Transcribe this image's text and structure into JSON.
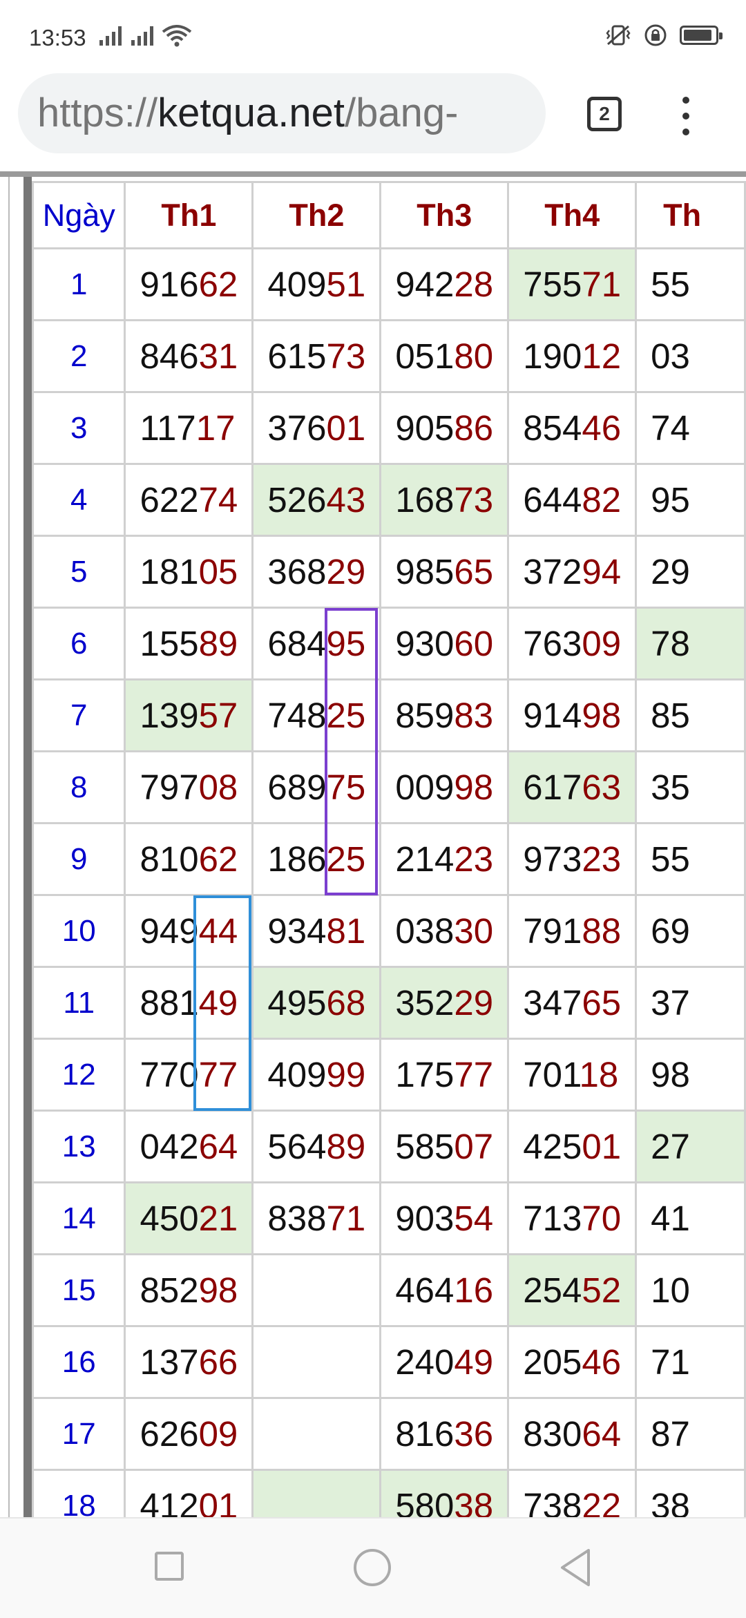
{
  "status_bar": {
    "time": "13:53",
    "icons": [
      "signal-icon",
      "signal-icon",
      "wifi-icon",
      "vibrate-icon",
      "rotation-lock-icon",
      "battery-icon"
    ]
  },
  "browser": {
    "url_scheme": "https://",
    "url_host": "ketqua.net",
    "url_path": "/bang-",
    "tab_count": "2"
  },
  "table": {
    "headers": [
      "Ngày",
      "Th1",
      "Th2",
      "Th3",
      "Th4",
      "Th"
    ],
    "rows": [
      {
        "day": "1",
        "cells": [
          {
            "h": "916",
            "t": "62"
          },
          {
            "h": "409",
            "t": "51"
          },
          {
            "h": "942",
            "t": "28"
          },
          {
            "h": "755",
            "t": "71"
          },
          {
            "h": "55",
            "t": ""
          }
        ]
      },
      {
        "day": "2",
        "cells": [
          {
            "h": "846",
            "t": "31"
          },
          {
            "h": "615",
            "t": "73"
          },
          {
            "h": "051",
            "t": "80"
          },
          {
            "h": "190",
            "t": "12"
          },
          {
            "h": "03",
            "t": ""
          }
        ]
      },
      {
        "day": "3",
        "cells": [
          {
            "h": "117",
            "t": "17"
          },
          {
            "h": "376",
            "t": "01"
          },
          {
            "h": "905",
            "t": "86"
          },
          {
            "h": "854",
            "t": "46"
          },
          {
            "h": "74",
            "t": ""
          }
        ]
      },
      {
        "day": "4",
        "cells": [
          {
            "h": "622",
            "t": "74"
          },
          {
            "h": "526",
            "t": "43"
          },
          {
            "h": "168",
            "t": "73"
          },
          {
            "h": "644",
            "t": "82"
          },
          {
            "h": "95",
            "t": ""
          }
        ]
      },
      {
        "day": "5",
        "cells": [
          {
            "h": "181",
            "t": "05"
          },
          {
            "h": "368",
            "t": "29"
          },
          {
            "h": "985",
            "t": "65"
          },
          {
            "h": "372",
            "t": "94"
          },
          {
            "h": "29",
            "t": ""
          }
        ]
      },
      {
        "day": "6",
        "cells": [
          {
            "h": "155",
            "t": "89"
          },
          {
            "h": "684",
            "t": "95"
          },
          {
            "h": "930",
            "t": "60"
          },
          {
            "h": "763",
            "t": "09"
          },
          {
            "h": "78",
            "t": ""
          }
        ]
      },
      {
        "day": "7",
        "cells": [
          {
            "h": "139",
            "t": "57"
          },
          {
            "h": "748",
            "t": "25"
          },
          {
            "h": "859",
            "t": "83"
          },
          {
            "h": "914",
            "t": "98"
          },
          {
            "h": "85",
            "t": ""
          }
        ]
      },
      {
        "day": "8",
        "cells": [
          {
            "h": "797",
            "t": "08"
          },
          {
            "h": "689",
            "t": "75"
          },
          {
            "h": "009",
            "t": "98"
          },
          {
            "h": "617",
            "t": "63"
          },
          {
            "h": "35",
            "t": ""
          }
        ]
      },
      {
        "day": "9",
        "cells": [
          {
            "h": "810",
            "t": "62"
          },
          {
            "h": "186",
            "t": "25"
          },
          {
            "h": "214",
            "t": "23"
          },
          {
            "h": "973",
            "t": "23"
          },
          {
            "h": "55",
            "t": ""
          }
        ]
      },
      {
        "day": "10",
        "cells": [
          {
            "h": "949",
            "t": "44"
          },
          {
            "h": "934",
            "t": "81"
          },
          {
            "h": "038",
            "t": "30"
          },
          {
            "h": "791",
            "t": "88"
          },
          {
            "h": "69",
            "t": ""
          }
        ]
      },
      {
        "day": "11",
        "cells": [
          {
            "h": "881",
            "t": "49"
          },
          {
            "h": "495",
            "t": "68"
          },
          {
            "h": "352",
            "t": "29"
          },
          {
            "h": "347",
            "t": "65"
          },
          {
            "h": "37",
            "t": ""
          }
        ]
      },
      {
        "day": "12",
        "cells": [
          {
            "h": "770",
            "t": "77"
          },
          {
            "h": "409",
            "t": "99"
          },
          {
            "h": "175",
            "t": "77"
          },
          {
            "h": "701",
            "t": "18"
          },
          {
            "h": "98",
            "t": ""
          }
        ]
      },
      {
        "day": "13",
        "cells": [
          {
            "h": "042",
            "t": "64"
          },
          {
            "h": "564",
            "t": "89"
          },
          {
            "h": "585",
            "t": "07"
          },
          {
            "h": "425",
            "t": "01"
          },
          {
            "h": "27",
            "t": ""
          }
        ]
      },
      {
        "day": "14",
        "cells": [
          {
            "h": "450",
            "t": "21"
          },
          {
            "h": "838",
            "t": "71"
          },
          {
            "h": "903",
            "t": "54"
          },
          {
            "h": "713",
            "t": "70"
          },
          {
            "h": "41",
            "t": ""
          }
        ]
      },
      {
        "day": "15",
        "cells": [
          {
            "h": "852",
            "t": "98"
          },
          {
            "h": "",
            "t": ""
          },
          {
            "h": "464",
            "t": "16"
          },
          {
            "h": "254",
            "t": "52"
          },
          {
            "h": "10",
            "t": ""
          }
        ]
      },
      {
        "day": "16",
        "cells": [
          {
            "h": "137",
            "t": "66"
          },
          {
            "h": "",
            "t": ""
          },
          {
            "h": "240",
            "t": "49"
          },
          {
            "h": "205",
            "t": "46"
          },
          {
            "h": "71",
            "t": ""
          }
        ]
      },
      {
        "day": "17",
        "cells": [
          {
            "h": "626",
            "t": "09"
          },
          {
            "h": "",
            "t": ""
          },
          {
            "h": "816",
            "t": "36"
          },
          {
            "h": "830",
            "t": "64"
          },
          {
            "h": "87",
            "t": ""
          }
        ]
      },
      {
        "day": "18",
        "cells": [
          {
            "h": "412",
            "t": "01"
          },
          {
            "h": "",
            "t": ""
          },
          {
            "h": "580",
            "t": "38"
          },
          {
            "h": "738",
            "t": "22"
          },
          {
            "h": "38",
            "t": ""
          }
        ]
      }
    ],
    "highlighted_cells": [
      {
        "row": "1",
        "col": "Th4"
      },
      {
        "row": "4",
        "col": "Th2"
      },
      {
        "row": "4",
        "col": "Th3"
      },
      {
        "row": "6",
        "col": "Th5"
      },
      {
        "row": "7",
        "col": "Th1"
      },
      {
        "row": "8",
        "col": "Th4"
      },
      {
        "row": "11",
        "col": "Th2"
      },
      {
        "row": "11",
        "col": "Th3"
      },
      {
        "row": "13",
        "col": "Th5"
      },
      {
        "row": "14",
        "col": "Th1"
      },
      {
        "row": "15",
        "col": "Th4"
      },
      {
        "row": "18",
        "col": "Th2"
      },
      {
        "row": "18",
        "col": "Th3"
      }
    ],
    "highlight_color": "#e0f0da",
    "tail_color": "#8b0000",
    "day_color": "#0000cc"
  },
  "annotations": [
    {
      "label": "purple-box",
      "color": "#7b3fcf",
      "column": "Th2",
      "rows": [
        "6",
        "7",
        "8",
        "9"
      ]
    },
    {
      "label": "blue-box",
      "color": "#2f8fd9",
      "column": "Th1",
      "rows": [
        "10",
        "11",
        "12"
      ]
    }
  ]
}
